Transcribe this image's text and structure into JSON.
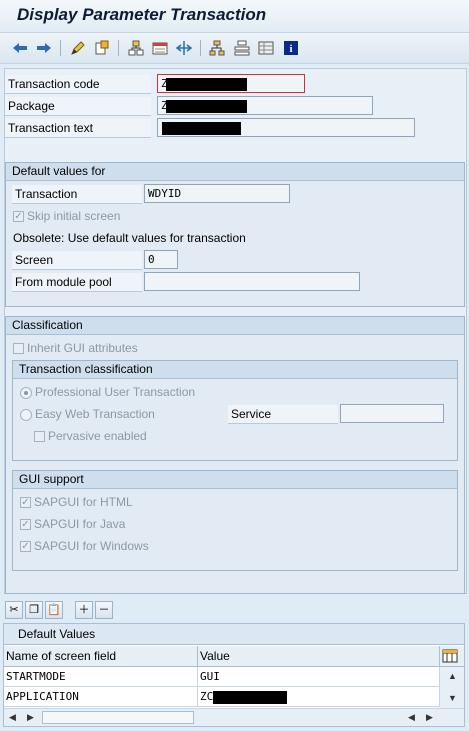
{
  "window": {
    "title": "Display Parameter Transaction"
  },
  "toolbar": {
    "buttons": [
      "back-icon",
      "forward-icon",
      "edit-pencil-icon",
      "other-object-icon",
      "hierarchy-icon",
      "display-list-icon",
      "navigate-icon",
      "tree-icon",
      "structure-icon",
      "layout-icon",
      "info-icon"
    ]
  },
  "header": {
    "transaction_code": {
      "label": "Transaction code",
      "value": "Z"
    },
    "package": {
      "label": "Package",
      "value": "Z"
    },
    "transaction_text": {
      "label": "Transaction text",
      "value": ""
    }
  },
  "defaults": {
    "title": "Default values for",
    "transaction": {
      "label": "Transaction",
      "value": "WDYID"
    },
    "skip_initial_screen": {
      "label": "Skip initial screen",
      "checked": true
    },
    "obsolete_note": "Obsolete: Use default values for transaction",
    "screen": {
      "label": "Screen",
      "value": "0"
    },
    "module_pool": {
      "label": "From module pool",
      "value": ""
    }
  },
  "classification": {
    "title": "Classification",
    "inherit_gui": {
      "label": "Inherit GUI attributes",
      "checked": false
    },
    "transaction_classification": {
      "title": "Transaction classification",
      "professional": {
        "label": "Professional User Transaction",
        "selected": true
      },
      "easy_web": {
        "label": "Easy Web Transaction",
        "selected": false
      },
      "service": {
        "label": "Service",
        "value": ""
      },
      "pervasive": {
        "label": "Pervasive enabled",
        "checked": false
      }
    },
    "gui_support": {
      "title": "GUI support",
      "html": {
        "label": "SAPGUI for HTML",
        "checked": true
      },
      "java": {
        "label": "SAPGUI for Java",
        "checked": true
      },
      "windows": {
        "label": "SAPGUI for Windows",
        "checked": true
      }
    }
  },
  "table": {
    "title": "Default Values",
    "columns": [
      "Name of screen field",
      "Value"
    ],
    "rows": [
      {
        "field": "STARTMODE",
        "value": "GUI"
      },
      {
        "field": "APPLICATION",
        "value": "ZC"
      }
    ]
  }
}
